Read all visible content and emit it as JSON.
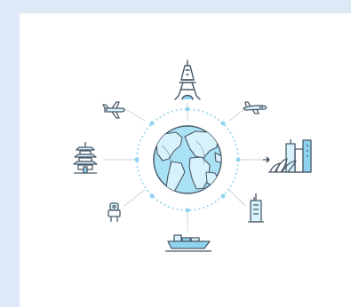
{
  "scene": {
    "background_color": "#dde9f6",
    "panel_color": "#ffffff",
    "accent_blue": "#8fd4ef",
    "outline_color": "#4a5968",
    "globe_water": "#a9e1f5",
    "globe_land": "#d8f2fb",
    "icons": [
      "eiffel-tower-icon",
      "airplane-left-icon",
      "airplane-right-icon",
      "pagoda-icon",
      "globe-icon",
      "city-opera-house-icon",
      "tourist-icon",
      "office-tower-icon",
      "cargo-ship-icon"
    ]
  }
}
